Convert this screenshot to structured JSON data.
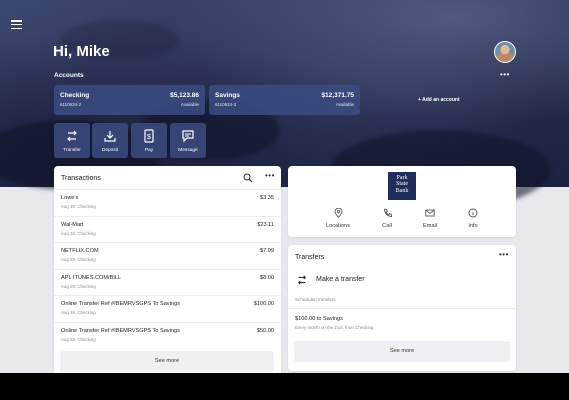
{
  "header": {
    "greeting": "Hi, Mike",
    "menu_icon": "hamburger-menu-icon",
    "avatar_icon": "user-avatar"
  },
  "accounts": {
    "title": "Accounts",
    "more_icon": "more-horizontal-icon",
    "items": [
      {
        "name": "Checking",
        "number": "6110634-2",
        "balance": "$5,123.86",
        "status": "Available"
      },
      {
        "name": "Savings",
        "number": "6110634-3",
        "balance": "$12,371.75",
        "status": "Available"
      }
    ],
    "add_label": "+ Add an account"
  },
  "actions": [
    {
      "label": "Transfer",
      "icon": "transfer-icon"
    },
    {
      "label": "Deposit",
      "icon": "deposit-icon"
    },
    {
      "label": "Pay",
      "icon": "pay-icon"
    },
    {
      "label": "Message",
      "icon": "message-icon"
    }
  ],
  "transactions": {
    "title": "Transactions",
    "search_icon": "search-icon",
    "more_icon": "more-horizontal-icon",
    "items": [
      {
        "description": "Lowe's",
        "date": "Aug 30, Checking",
        "amount": "$3.35"
      },
      {
        "description": "Wal-Mart",
        "date": "Aug 30, Checking",
        "amount": "$23.11"
      },
      {
        "description": "NETFLIX.COM",
        "date": "Aug 29, Checking",
        "amount": "$7.99"
      },
      {
        "description": "APL ITUNES.COM/BILL",
        "date": "Aug 28, Checking",
        "amount": "$8.00"
      },
      {
        "description": "Online Transfer Ref #IBEMRVSGPS To Savings",
        "date": "Aug 28, Checking",
        "amount": "$100.00"
      },
      {
        "description": "Online Transfer Ref #IBEMRVSGPS To Savings",
        "date": "Aug 28, Checking",
        "amount": "$50.00"
      }
    ],
    "see_more": "See more"
  },
  "bank": {
    "logo_line1": "Park",
    "logo_line2": "State",
    "logo_line3": "Bank",
    "links": [
      {
        "label": "Locations",
        "icon": "location-pin-icon"
      },
      {
        "label": "Call",
        "icon": "phone-icon"
      },
      {
        "label": "Email",
        "icon": "envelope-icon"
      },
      {
        "label": "Info",
        "icon": "info-icon"
      }
    ]
  },
  "transfers": {
    "title": "Transfers",
    "more_icon": "more-horizontal-icon",
    "make_label": "Make a transfer",
    "scheduled_label": "Scheduled transfers",
    "scheduled_amount": "$100.00 to Savings",
    "scheduled_freq": "Every month on the 21st, from Checking",
    "see_more": "See more"
  },
  "colors": {
    "hero_dark": "#1c2240",
    "card_blue": "#3c4c82",
    "background": "#e6e8ec",
    "bank_logo": "#1f2d5c"
  }
}
